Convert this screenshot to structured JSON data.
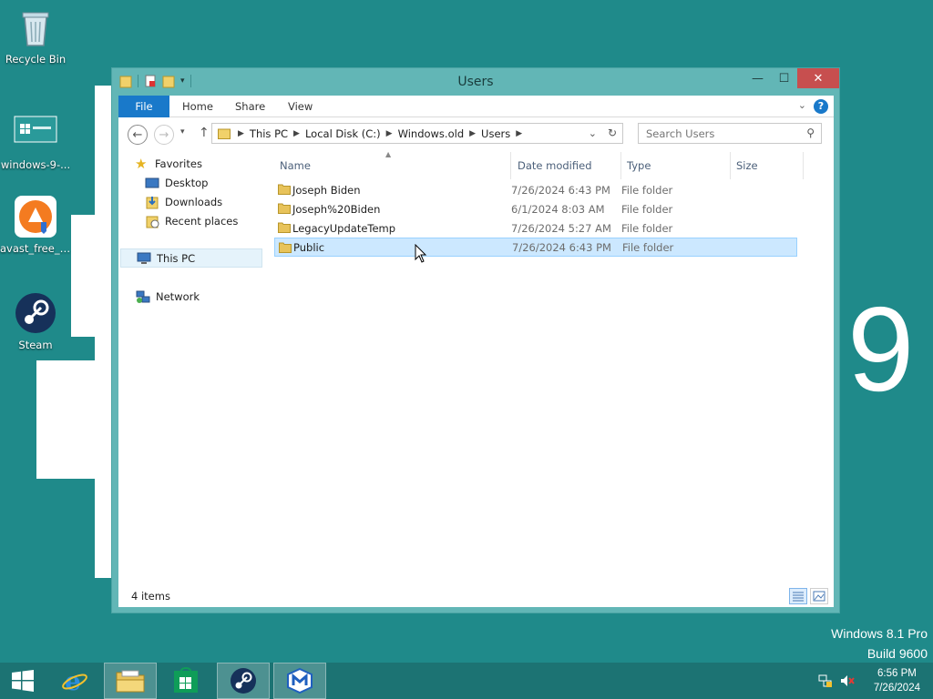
{
  "desktop": {
    "icons": [
      {
        "label": "Recycle Bin",
        "icon": "recycle-bin-icon"
      },
      {
        "label": "windows-9-...",
        "icon": "windows9-file-icon"
      },
      {
        "label": "avast_free_a...",
        "icon": "avast-icon"
      },
      {
        "label": "Steam",
        "icon": "steam-icon"
      }
    ],
    "wallpaper_number": "9",
    "edition_line1": "Windows 8.1 Pro",
    "edition_line2": "Build 9600"
  },
  "window": {
    "title": "Users",
    "ribbon_tabs": [
      "File",
      "Home",
      "Share",
      "View"
    ],
    "address": {
      "segments": [
        "This PC",
        "Local Disk (C:)",
        "Windows.old",
        "Users"
      ]
    },
    "search_placeholder": "Search Users",
    "nav": {
      "favorites_label": "Favorites",
      "favorites": [
        "Desktop",
        "Downloads",
        "Recent places"
      ],
      "this_pc": "This PC",
      "network": "Network"
    },
    "columns": [
      "Name",
      "Date modified",
      "Type",
      "Size"
    ],
    "rows": [
      {
        "name": "Joseph Biden",
        "date": "7/26/2024 6:43 PM",
        "type": "File folder"
      },
      {
        "name": "Joseph%20Biden",
        "date": "6/1/2024 8:03 AM",
        "type": "File folder"
      },
      {
        "name": "LegacyUpdateTemp",
        "date": "7/26/2024 5:27 AM",
        "type": "File folder"
      },
      {
        "name": "Public",
        "date": "7/26/2024 6:43 PM",
        "type": "File folder"
      }
    ],
    "status": "4 items"
  },
  "taskbar": {
    "time": "6:56 PM",
    "date": "7/26/2024"
  },
  "colors": {
    "desktop": "#1f8a8a",
    "window_frame": "#62b6b6",
    "file_tab": "#1979ca",
    "close_button": "#c74f4f",
    "folder": "#e8c35a",
    "selection": "#cce8ff"
  }
}
